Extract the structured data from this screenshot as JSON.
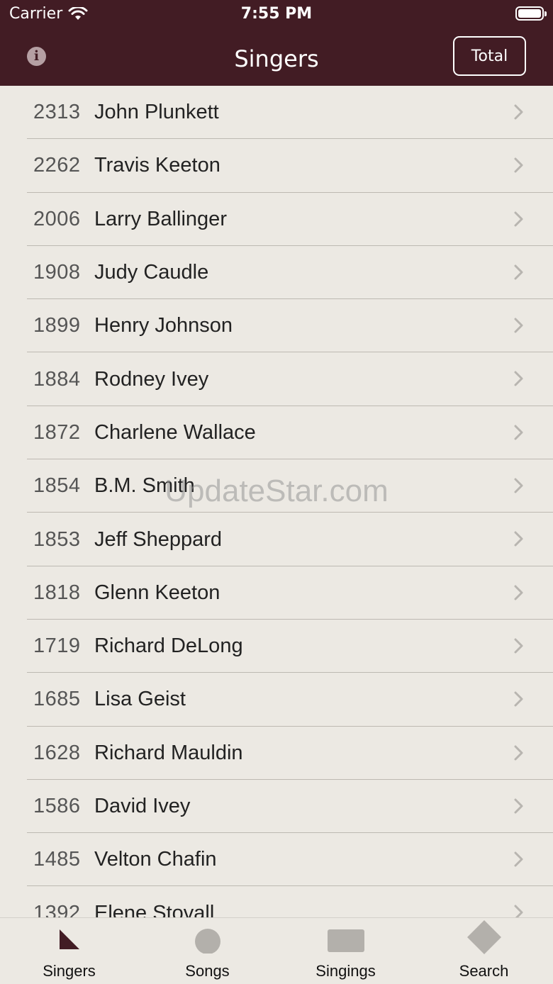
{
  "status_bar": {
    "carrier": "Carrier",
    "time": "7:55 PM"
  },
  "nav": {
    "title": "Singers",
    "total_button": "Total",
    "info_icon": "i"
  },
  "rows": [
    {
      "count": "2313",
      "name": "John Plunkett"
    },
    {
      "count": "2262",
      "name": "Travis Keeton"
    },
    {
      "count": "2006",
      "name": "Larry Ballinger"
    },
    {
      "count": "1908",
      "name": "Judy Caudle"
    },
    {
      "count": "1899",
      "name": "Henry Johnson"
    },
    {
      "count": "1884",
      "name": "Rodney Ivey"
    },
    {
      "count": "1872",
      "name": "Charlene Wallace"
    },
    {
      "count": "1854",
      "name": "B.M. Smith"
    },
    {
      "count": "1853",
      "name": "Jeff Sheppard"
    },
    {
      "count": "1818",
      "name": "Glenn Keeton"
    },
    {
      "count": "1719",
      "name": "Richard DeLong"
    },
    {
      "count": "1685",
      "name": "Lisa Geist"
    },
    {
      "count": "1628",
      "name": "Richard Mauldin"
    },
    {
      "count": "1586",
      "name": "David Ivey"
    },
    {
      "count": "1485",
      "name": "Velton Chafin"
    },
    {
      "count": "1392",
      "name": "Elene Stovall"
    }
  ],
  "watermark": "UpdateStar.com",
  "tabs": [
    {
      "label": "Singers",
      "icon": "triangle-icon",
      "selected": true
    },
    {
      "label": "Songs",
      "icon": "circle-icon",
      "selected": false
    },
    {
      "label": "Singings",
      "icon": "rectangle-icon",
      "selected": false
    },
    {
      "label": "Search",
      "icon": "diamond-icon",
      "selected": false
    }
  ],
  "colors": {
    "accent": "#421C24",
    "background": "#ECE9E3",
    "inactive_icon": "#B3B0AB"
  }
}
